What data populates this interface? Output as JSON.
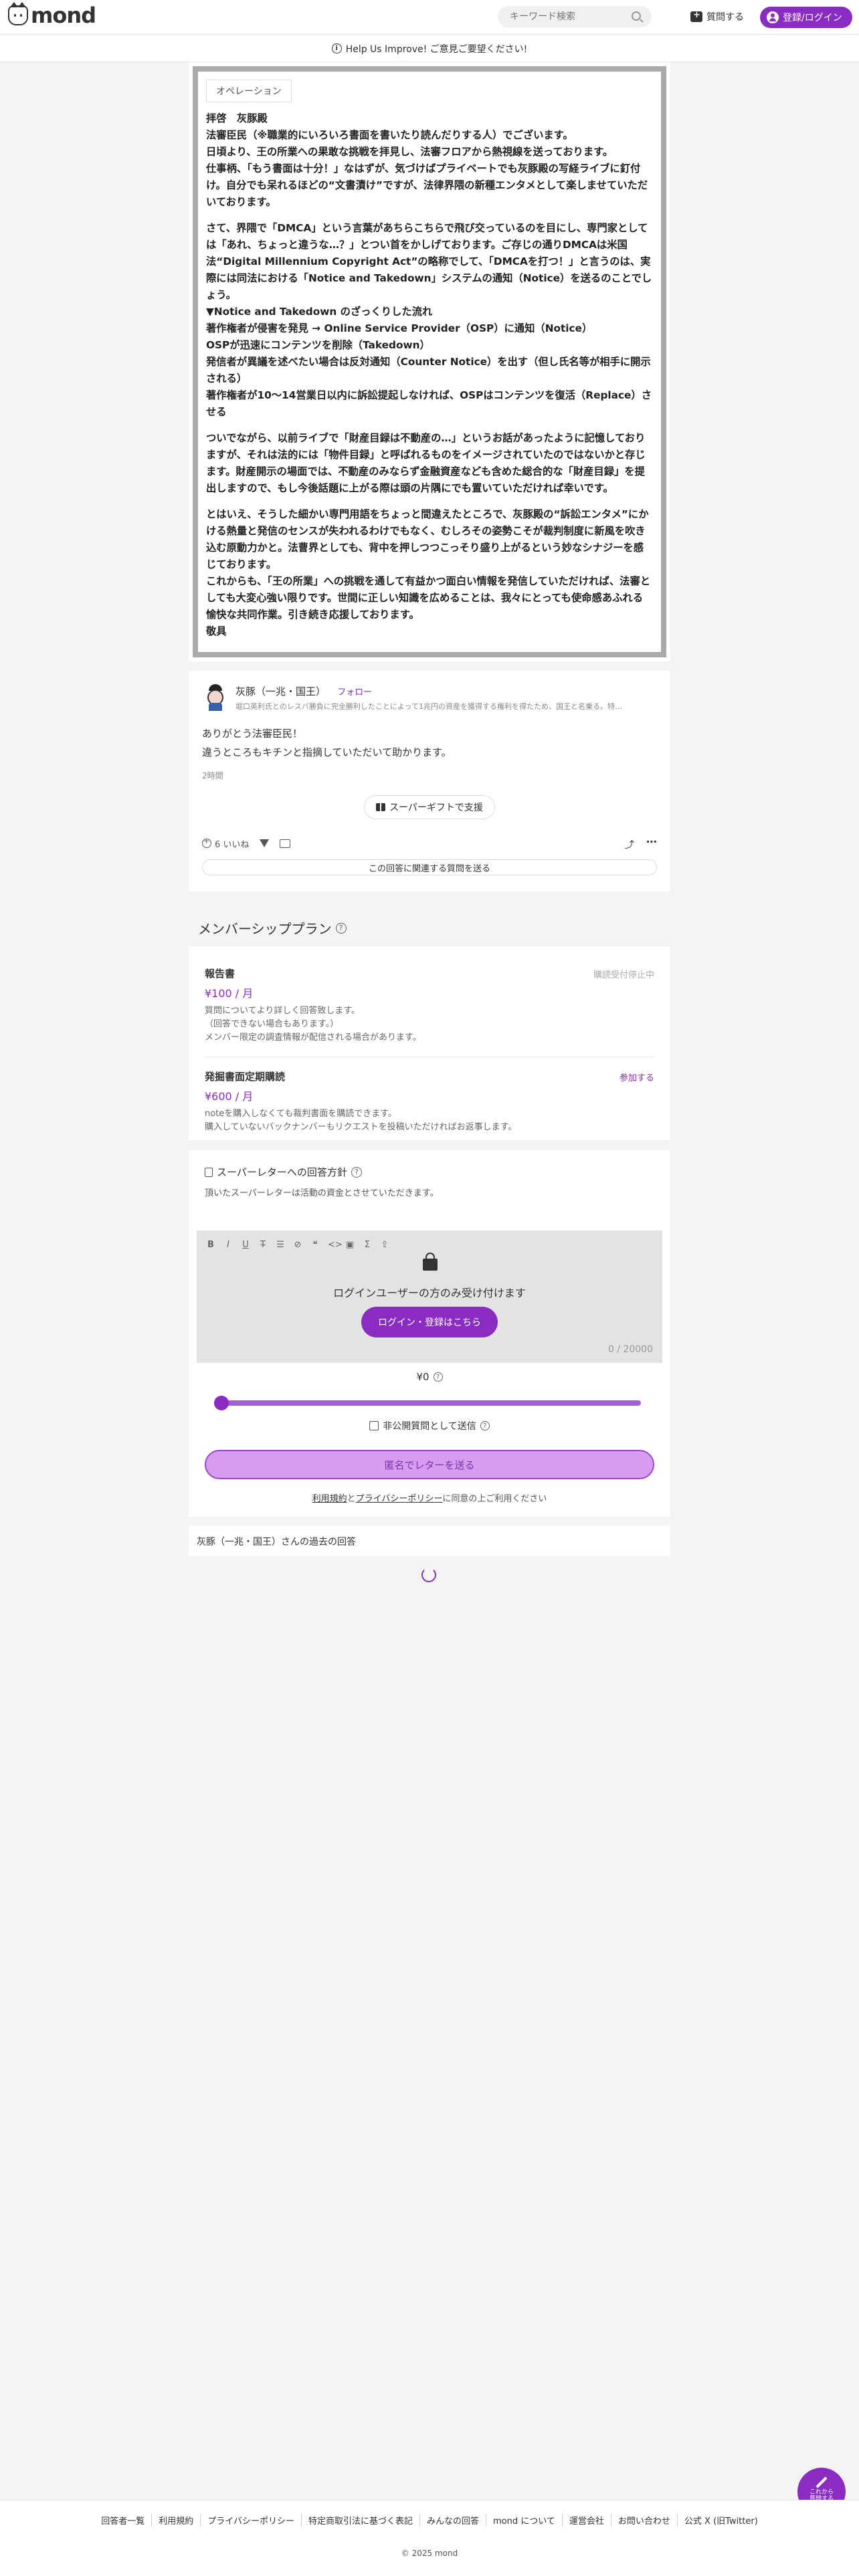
{
  "header": {
    "logo_text": "mond",
    "search_placeholder": "キーワード検索",
    "ask_label": "質問する",
    "login_label": "登録/ログイン"
  },
  "banner": {
    "text": "Help Us Improve! ご意見ご要望ください!"
  },
  "answer": {
    "tag": "オペレーション",
    "paragraphs": [
      [
        "拝啓　灰豚殿",
        "法審臣民（※職業的にいろいろ書面を書いたり読んだりする人）でございます。",
        "日頃より、王の所業への果敢な挑戦を拝見し、法審フロアから熱視線を送っております。",
        "仕事柄、「もう書面は十分！」なはずが、気づけばプライベートでも灰豚殿の写経ライブに釘付け。自分でも呆れるほどの“文書漬け”ですが、法律界隈の新種エンタメとして楽しませていただいております。"
      ],
      [
        "さて、界隈で「DMCA」という言葉があちらこちらで飛び交っているのを目にし、専門家としては「あれ、ちょっと違うな…？」とつい首をかしげております。ご存じの通りDMCAは米国法“Digital Millennium Copyright Act”の略称でして、「DMCAを打つ！」と言うのは、実際には同法における「Notice and Takedown」システムの通知（Notice）を送るのことでしょう。",
        "▼Notice and Takedown のざっくりした流れ",
        "著作権者が侵害を発見 → Online Service Provider（OSP）に通知（Notice）",
        "OSPが迅速にコンテンツを削除（Takedown）",
        "発信者が異議を述べたい場合は反対通知（Counter Notice）を出す（但し氏名等が相手に開示される）",
        "著作権者が10〜14営業日以内に訴訟提起しなければ、OSPはコンテンツを復活（Replace）させる"
      ],
      [
        "ついでながら、以前ライブで「財産目録は不動産の…」というお話があったように記憶しておりますが、それは法的には「物件目録」と呼ばれるものをイメージされていたのではないかと存じます。財産開示の場面では、不動産のみならず金融資産なども含めた総合的な「財産目録」を提出しますので、もし今後話題に上がる際は頭の片隅にでも置いていただければ幸いです。"
      ],
      [
        "とはいえ、そうした細かい専門用語をちょっと間違えたところで、灰豚殿の“訴訟エンタメ”にかける熱量と発信のセンスが失われるわけでもなく、むしろその姿勢こそが裁判制度に新風を吹き込む原動力かと。法曹界としても、背中を押しつつこっそり盛り上がるという妙なシナジーを感じております。",
        "これからも、「王の所業」への挑戦を通して有益かつ面白い情報を発信していただければ、法審としても大変心強い限りです。世間に正しい知識を広めることは、我々にとっても使命感あふれる愉快な共同作業。引き続き応援しております。",
        "敬具"
      ]
    ]
  },
  "comment": {
    "name": "灰豚（一兆・国王）",
    "follow": "フォロー",
    "bio": "堀口英利氏とのレスバ勝負に完全勝利したことによって1兆円の資産を獲得する権利を得たため、国王と名乗る。特…",
    "lines": [
      "ありがとう法審臣民！",
      "違うところもキチンと指摘していただいて助かります。"
    ],
    "time": "2時間",
    "gift": "スーパーギフトで支援",
    "likes": "6 いいね",
    "related": "この回答に関連する質問を送る"
  },
  "membership": {
    "title": "メンバーシッププラン",
    "plans": [
      {
        "name": "報告書",
        "price": "¥100 / 月",
        "status": "購読受付停止中",
        "desc": [
          "質問についてより詳しく回答致します。",
          "（回答できない場合もあります。）",
          "メンバー限定の調査情報が配信される場合があります。"
        ]
      },
      {
        "name": "発掘書面定期購読",
        "price": "¥600 / 月",
        "status": "参加する",
        "desc": [
          "noteを購入しなくても裁判書面を購読できます。",
          "購入していないバックナンバーもリクエストを投稿いただければお返事します。"
        ]
      }
    ]
  },
  "super_letter": {
    "policy_title": "スーパーレターへの回答方針",
    "policy_desc": "頂いたスーパーレターは活動の資金とさせていただきます。",
    "editor_msg": "ログインユーザーの方のみ受け付けます",
    "login_btn": "ログイン・登録はこちら",
    "count": "0 / 20000",
    "amount": "¥0",
    "amount_fraction": 0,
    "private_label": "非公開質問として送信",
    "send_label": "匿名でレターを送る",
    "terms_a": "利用規約",
    "terms_mid": "と",
    "terms_b": "プライバシーポリシー",
    "terms_c": "に同意の上ご利用ください"
  },
  "past": {
    "title": "灰豚（一兆・国王）さんの過去の回答"
  },
  "fab": {
    "label1": "これから",
    "label2": "質問する"
  },
  "footer": {
    "links": [
      "回答者一覧",
      "利用規約",
      "プライバシーポリシー",
      "特定商取引法に基づく表記",
      "みんなの回答",
      "mond について",
      "運営会社",
      "お問い合わせ",
      "公式 X (旧Twitter)"
    ],
    "copyright": "© 2025 mond"
  }
}
